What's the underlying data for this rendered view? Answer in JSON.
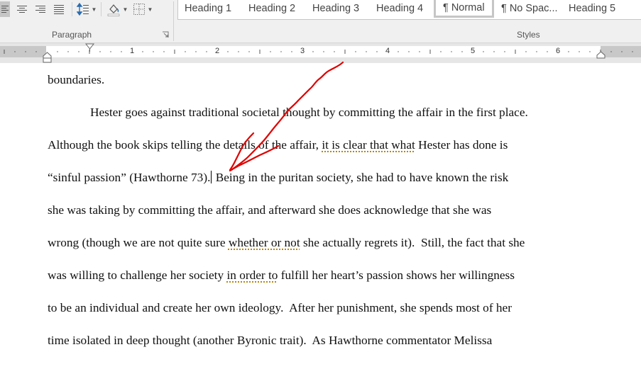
{
  "ribbon": {
    "paragraph_group": {
      "label": "Paragraph",
      "buttons": [
        {
          "name": "align-left",
          "selected": true
        },
        {
          "name": "align-center"
        },
        {
          "name": "align-right"
        },
        {
          "name": "justify"
        },
        {
          "name": "line-spacing"
        },
        {
          "name": "shading"
        },
        {
          "name": "borders"
        }
      ]
    },
    "styles_group": {
      "label": "Styles",
      "items": [
        "Heading 1",
        "Heading 2",
        "Heading 3",
        "Heading 4",
        "¶ Normal",
        "¶ No Spac...",
        "Heading 5"
      ],
      "active": "¶ Normal"
    }
  },
  "ruler": {
    "numbers": [
      "1",
      "2",
      "3",
      "4",
      "5",
      "6"
    ]
  },
  "document": {
    "lines": [
      {
        "id": "l0",
        "segments": [
          {
            "text": "boundaries."
          }
        ]
      },
      {
        "id": "l1",
        "segments": [
          {
            "text": "Hester goes against traditional societal thought by committing the affair in the first place."
          }
        ]
      },
      {
        "id": "l2",
        "segments": [
          {
            "text": "Although the book skips telling the details of the affair, "
          },
          {
            "text": "it is clear that what",
            "grammar": true
          },
          {
            "text": " Hester has done is"
          }
        ]
      },
      {
        "id": "l3",
        "segments": [
          {
            "text": "“sinful passion” (Hawthorne 73)."
          },
          {
            "cursor": true
          },
          {
            "text": " Being in the puritan society, she had to have known the risk"
          }
        ]
      },
      {
        "id": "l4",
        "segments": [
          {
            "text": "she was taking by committing the affair, and afterward she does acknowledge that she was"
          }
        ]
      },
      {
        "id": "l5",
        "segments": [
          {
            "text": "wrong (though we are not quite sure "
          },
          {
            "text": "whether or not",
            "grammar": true
          },
          {
            "text": " she actually regrets it).  Still, the fact that she"
          }
        ]
      },
      {
        "id": "l6",
        "segments": [
          {
            "text": "was willing to challenge her society "
          },
          {
            "text": "in order to",
            "grammar": true
          },
          {
            "text": " fulfill her heart’s passion shows her willingness"
          }
        ]
      },
      {
        "id": "l7",
        "segments": [
          {
            "text": "to be an individual and create her own ideology.  After her punishment, she spends most of her"
          }
        ]
      },
      {
        "id": "l8",
        "segments": [
          {
            "text": "time isolated in deep thought (another Byronic trait).  As Hawthorne commentator Melissa"
          }
        ]
      }
    ]
  },
  "annotation": {
    "type": "hand-drawn arrow",
    "color": "#e00000"
  },
  "colors": {
    "ribbon_bg": "#f0f0f0",
    "ink": "#e00000",
    "grammar_underline": "#b8860b"
  }
}
